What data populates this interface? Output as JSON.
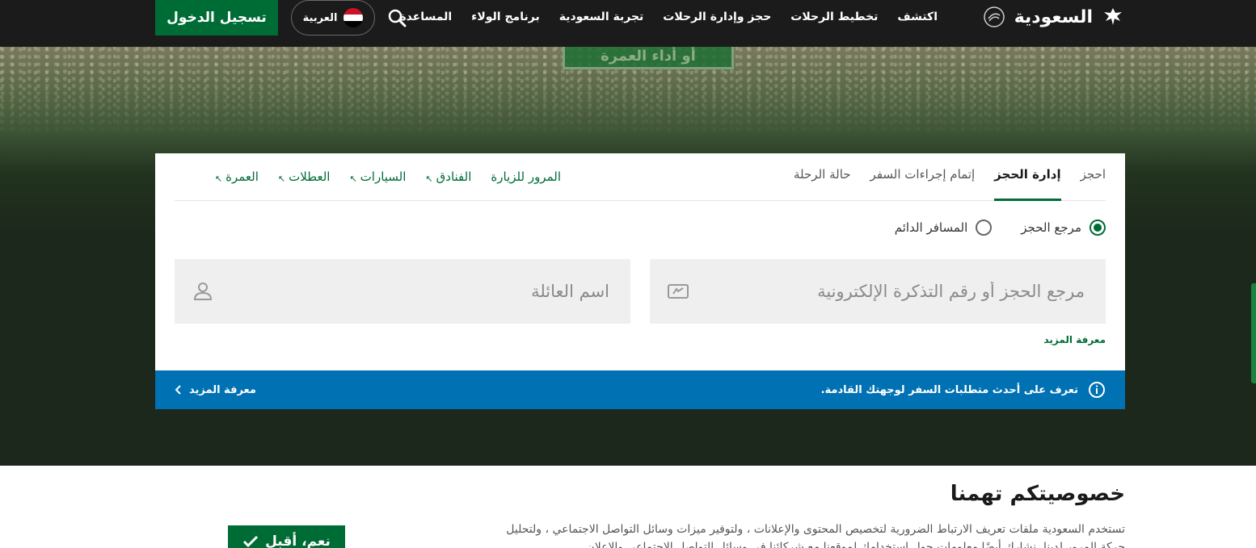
{
  "header": {
    "brand": "السعودية",
    "nav": [
      "اكتشف",
      "تخطيط الرحلات",
      "حجز وإدارة الرحلات",
      "تجربة السعودية",
      "برنامج الولاء",
      "المساعدة"
    ],
    "language": "العربية",
    "login_label": "تسجيل الدخول",
    "flag_colors": [
      "#ce1126",
      "#ffffff",
      "#000000"
    ]
  },
  "hero": {
    "banner_text": "أو أداء العمرة"
  },
  "booking": {
    "tabs": [
      {
        "label": "احجز",
        "active": false
      },
      {
        "label": "إدارة الحجز",
        "active": true
      },
      {
        "label": "إتمام إجراءات السفر",
        "active": false
      },
      {
        "label": "حالة الرحلة",
        "active": false
      }
    ],
    "external_links": [
      "المرور للزيارة",
      "الفنادق",
      "السيارات",
      "العطلات",
      "العمرة"
    ],
    "radios": [
      {
        "label": "مرجع الحجز",
        "checked": true
      },
      {
        "label": "المسافر الدائم",
        "checked": false
      }
    ],
    "ref_placeholder": "مرجع الحجز أو رقم التذكرة الإلكترونية",
    "name_placeholder": "اسم العائلة",
    "learn_more": "معرفة المزيد"
  },
  "info_bar": {
    "text": "تعرف على أحدث متطلبات السفر لوجهتك القادمة.",
    "link": "معرفة المزيد"
  },
  "cookie": {
    "title": "خصوصيتكم تهمنا",
    "text": "تستخدم السعودية ملفات تعريف الارتباط الضرورية لتخصيص المحتوى والإعلانات ، ولتوفير ميزات وسائل التواصل الاجتماعي ، ولتحليل حركة المرور لدينا. نشارك أيضًا معلومات حول استخدامك لموقعنا مع شركائنا في وسائل التواصل الاجتماعي والإعلان",
    "accept_label": "نعم، أقبل"
  },
  "colors": {
    "brand_green": "#006c35",
    "info_blue": "#0071b3",
    "topbar": "#1b1b1b"
  }
}
